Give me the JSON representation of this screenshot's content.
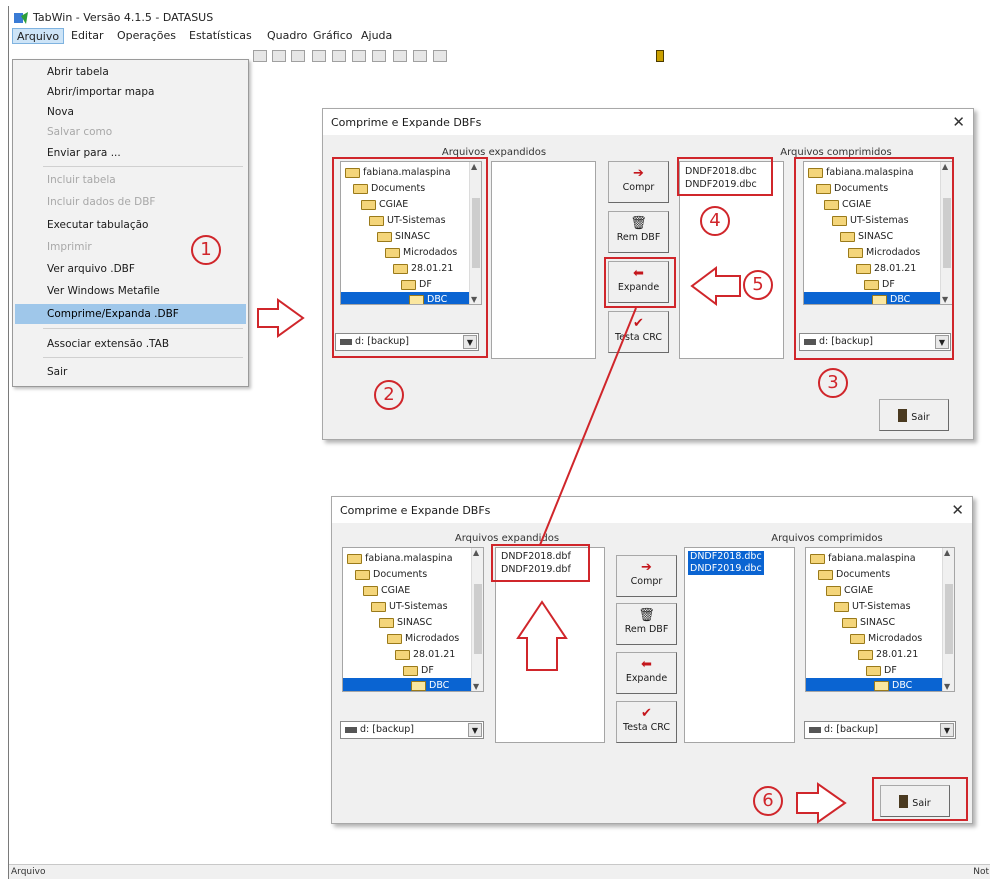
{
  "window": {
    "title": "TabWin - Versão 4.1.5 - DATASUS"
  },
  "menubar": [
    "Arquivo",
    "Editar",
    "Operações",
    "Estatísticas",
    "Quadro",
    "Gráfico",
    "Ajuda"
  ],
  "file_menu": {
    "items": [
      {
        "label": "Abrir tabela",
        "enabled": true
      },
      {
        "label": "Abrir/importar mapa",
        "enabled": true
      },
      {
        "label": "Nova",
        "enabled": true
      },
      {
        "label": "Salvar como",
        "enabled": false
      },
      {
        "label": "Enviar para ...",
        "enabled": true
      },
      {
        "label": "Incluir tabela",
        "enabled": false
      },
      {
        "label": "Incluir dados de DBF",
        "enabled": false
      },
      {
        "label": "Executar tabulação",
        "enabled": true
      },
      {
        "label": "Imprimir",
        "enabled": false
      },
      {
        "label": "Ver arquivo .DBF",
        "enabled": true
      },
      {
        "label": "Ver Windows Metafile",
        "enabled": true
      },
      {
        "label": "Comprime/Expanda .DBF",
        "enabled": true,
        "selected": true
      },
      {
        "label": "Associar extensão .TAB",
        "enabled": true
      },
      {
        "label": "Sair",
        "enabled": true
      }
    ]
  },
  "dialog_top": {
    "title": "Comprime e Expande DBFs",
    "expanded_label": "Arquivos expandidos",
    "compressed_label": "Arquivos comprimidos",
    "tree_left": [
      "fabiana.malaspina",
      "Documents",
      "CGIAE",
      "UT-Sistemas",
      "SINASC",
      "Microdados",
      "28.01.21",
      "DF",
      "DBC"
    ],
    "tree_right": [
      "fabiana.malaspina",
      "Documents",
      "CGIAE",
      "UT-Sistemas",
      "SINASC",
      "Microdados",
      "28.01.21",
      "DF",
      "DBC"
    ],
    "expanded_files": [],
    "compressed_files": [
      "DNDF2018.dbc",
      "DNDF2019.dbc"
    ],
    "drive_left": "d: [backup]",
    "drive_right": "d: [backup]",
    "buttons": {
      "compr": "Compr",
      "rem": "Rem DBF",
      "expande": "Expande",
      "testa": "Testa CRC"
    },
    "exit_label": "Sair"
  },
  "dialog_bottom": {
    "title": "Comprime e Expande DBFs",
    "expanded_label": "Arquivos expandidos",
    "compressed_label": "Arquivos comprimidos",
    "tree_left": [
      "fabiana.malaspina",
      "Documents",
      "CGIAE",
      "UT-Sistemas",
      "SINASC",
      "Microdados",
      "28.01.21",
      "DF",
      "DBC"
    ],
    "tree_right": [
      "fabiana.malaspina",
      "Documents",
      "CGIAE",
      "UT-Sistemas",
      "SINASC",
      "Microdados",
      "28.01.21",
      "DF",
      "DBC"
    ],
    "expanded_files": [
      "DNDF2018.dbf",
      "DNDF2019.dbf"
    ],
    "compressed_files": [
      "DNDF2018.dbc",
      "DNDF2019.dbc"
    ],
    "drive_left": "d: [backup]",
    "drive_right": "d: [backup]",
    "buttons": {
      "compr": "Compr",
      "rem": "Rem DBF",
      "expande": "Expande",
      "testa": "Testa CRC"
    },
    "exit_label": "Sair"
  },
  "annotations": [
    "1",
    "2",
    "3",
    "4",
    "5",
    "6"
  ],
  "statusbar": {
    "left": "Arquivo",
    "right": "Not"
  },
  "colors": {
    "annotation_red": "#d0262b",
    "selection_blue": "#0a64d2",
    "menu_highlight": "#9fc7ea"
  }
}
